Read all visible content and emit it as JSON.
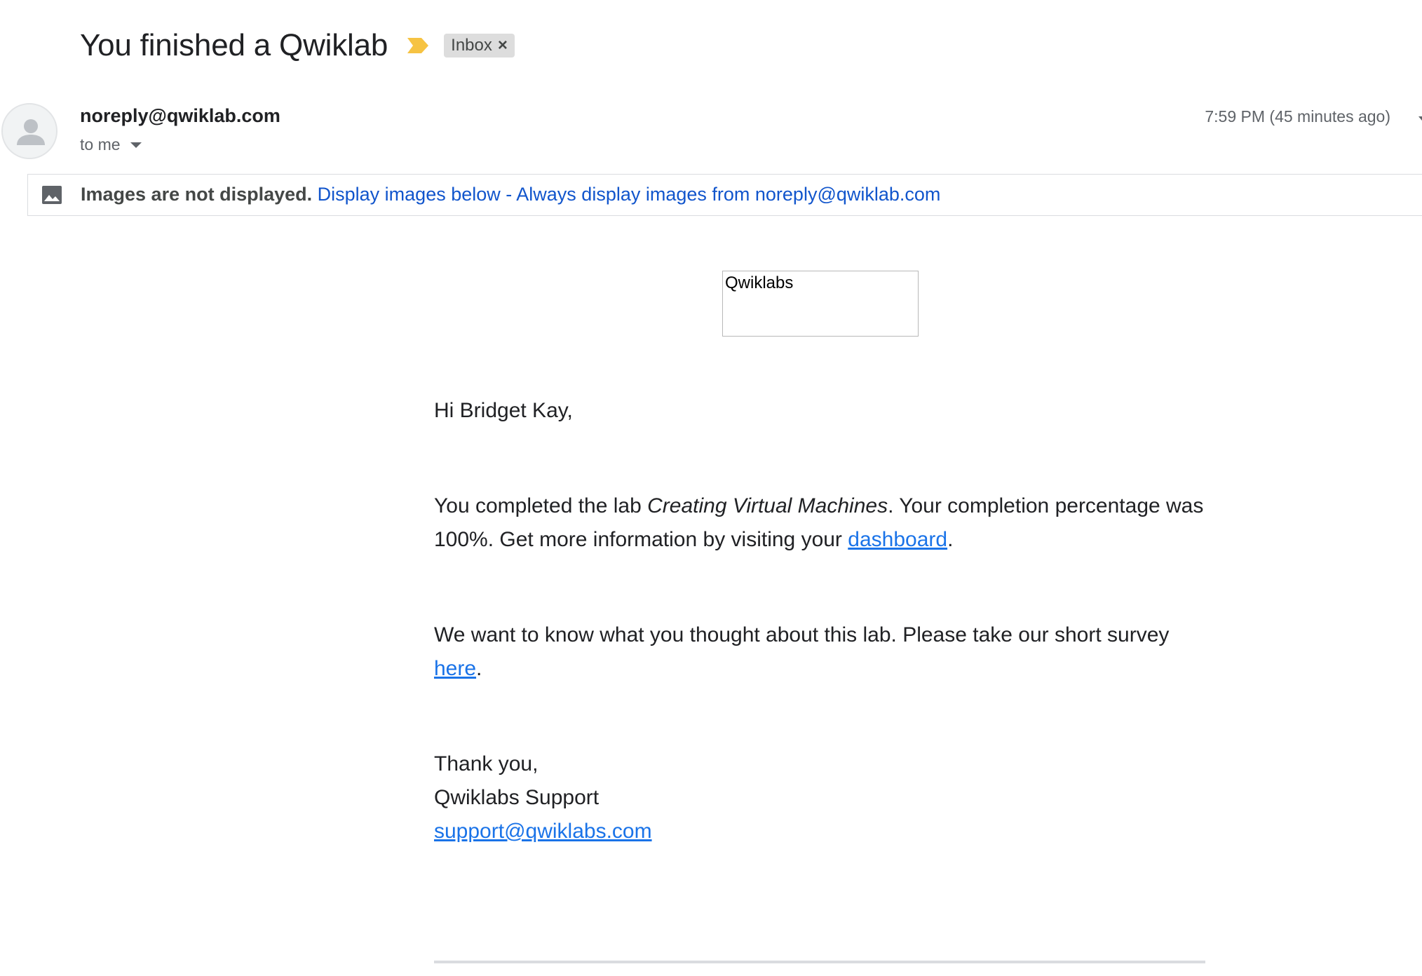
{
  "subject": "You finished a Qwiklab",
  "label": {
    "name": "Inbox",
    "remove_glyph": "×"
  },
  "icons": [
    "importance-marker-icon",
    "avatar-placeholder-icon",
    "chevron-down-icon",
    "image-icon"
  ],
  "colors": {
    "importance": "#f6c343",
    "link": "#1a73e8",
    "banner_link": "#1155cc"
  },
  "sender": {
    "email": "noreply@qwiklab.com",
    "recipient": "to me",
    "time": "7:59 PM (45 minutes ago)"
  },
  "image_banner": {
    "notice": "Images are not displayed.",
    "display_below": "Display images below",
    "separator": " - ",
    "always_display": "Always display images from noreply@qwiklab.com"
  },
  "email_body": {
    "logo_alt": "Qwiklabs",
    "greeting": "Hi Bridget Kay,",
    "p1_prefix": "You completed the lab ",
    "lab_name": "Creating Virtual Machines",
    "p1_mid": ". Your completion percentage was 100%. Get more information by visiting your ",
    "dashboard_link": "dashboard",
    "p1_suffix": ".",
    "p2_prefix": "We want to know what you thought about this lab. Please take our short survey ",
    "survey_link": "here",
    "p2_suffix": ".",
    "signoff_line1": "Thank you,",
    "signoff_line2": "Qwiklabs Support",
    "support_email": "support@qwiklabs.com"
  }
}
